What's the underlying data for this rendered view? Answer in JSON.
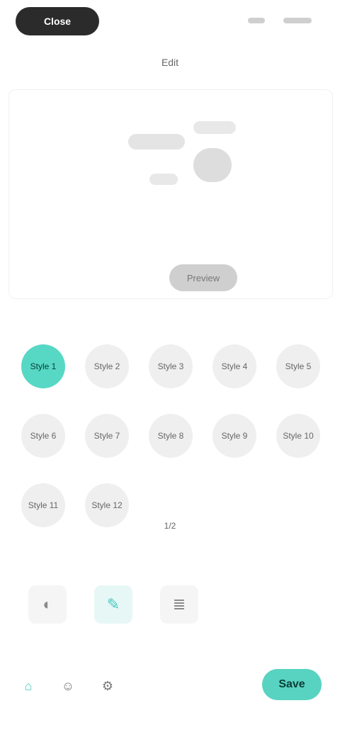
{
  "top": {
    "pill_label": "Close",
    "title": "Edit"
  },
  "preview": {
    "caption": "Preview"
  },
  "grid": {
    "items": [
      {
        "label": "Style 1",
        "active": true
      },
      {
        "label": "Style 2",
        "active": false
      },
      {
        "label": "Style 3",
        "active": false
      },
      {
        "label": "Style 4",
        "active": false
      },
      {
        "label": "Style 5",
        "active": false
      },
      {
        "label": "Style 6",
        "active": false
      },
      {
        "label": "Style 7",
        "active": false
      },
      {
        "label": "Style 8",
        "active": false
      },
      {
        "label": "Style 9",
        "active": false
      },
      {
        "label": "Style 10",
        "active": false
      },
      {
        "label": "Style 11",
        "active": false
      },
      {
        "label": "Style 12",
        "active": false
      }
    ],
    "page_indicator": "1/2"
  },
  "tools": [
    {
      "icon": "color-icon",
      "glyph": "◐",
      "accent": false
    },
    {
      "icon": "brush-icon",
      "glyph": "✎",
      "accent": true
    },
    {
      "icon": "layers-icon",
      "glyph": "≣",
      "accent": false
    }
  ],
  "footer": {
    "icons": [
      {
        "icon": "home-icon",
        "glyph": "⌂",
        "accent": true
      },
      {
        "icon": "user-icon",
        "glyph": "☺",
        "accent": false
      },
      {
        "icon": "gear-icon",
        "glyph": "⚙",
        "accent": false
      }
    ],
    "primary_label": "Save"
  }
}
